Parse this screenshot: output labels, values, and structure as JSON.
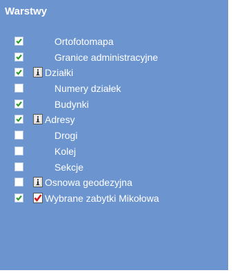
{
  "panel": {
    "title": "Warstwy",
    "background": "#6c95cf",
    "check_color": "#2e9a2e"
  },
  "layers": [
    {
      "label": "Ortofotomapa",
      "checked": true,
      "icon": ""
    },
    {
      "label": "Granice administracyjne",
      "checked": true,
      "icon": ""
    },
    {
      "label": "Działki",
      "checked": true,
      "icon": "info-icon"
    },
    {
      "label": "Numery działek",
      "checked": false,
      "icon": ""
    },
    {
      "label": "Budynki",
      "checked": true,
      "icon": ""
    },
    {
      "label": "Adresy",
      "checked": true,
      "icon": "info-icon"
    },
    {
      "label": "Drogi",
      "checked": false,
      "icon": ""
    },
    {
      "label": "Kolej",
      "checked": false,
      "icon": ""
    },
    {
      "label": "Sekcje",
      "checked": false,
      "icon": ""
    },
    {
      "label": "Osnowa geodezyjna",
      "checked": false,
      "icon": "info-icon"
    },
    {
      "label": "Wybrane zabytki Mikołowa",
      "checked": true,
      "icon": "red-check-icon"
    }
  ]
}
